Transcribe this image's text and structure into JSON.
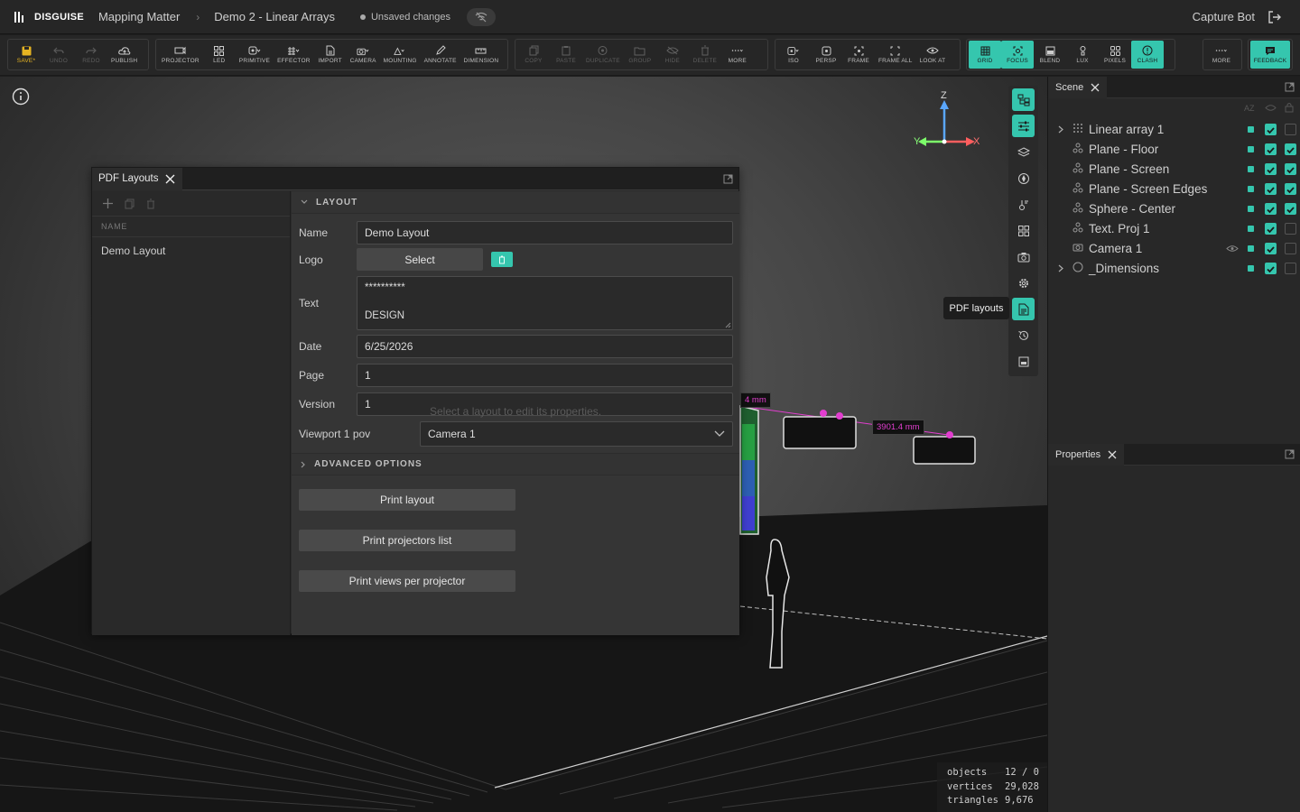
{
  "app": {
    "brand": "DISGUISE",
    "breadcrumb": [
      "Mapping Matter",
      "Demo 2 - Linear Arrays"
    ],
    "status": "Unsaved changes",
    "user": "Capture Bot"
  },
  "toolbar": {
    "file": [
      {
        "label": "SAVE*",
        "icon": "save-icon",
        "state": "accent"
      },
      {
        "label": "UNDO",
        "icon": "undo-icon",
        "state": "disabled"
      },
      {
        "label": "REDO",
        "icon": "redo-icon",
        "state": "disabled"
      },
      {
        "label": "PUBLISH",
        "icon": "cloud-upload-icon"
      }
    ],
    "create": [
      {
        "label": "PROJECTOR",
        "icon": "projector-icon"
      },
      {
        "label": "LED",
        "icon": "led-grid-icon"
      },
      {
        "label": "PRIMITIVE",
        "icon": "primitive-icon"
      },
      {
        "label": "EFFECTOR",
        "icon": "effector-icon"
      },
      {
        "label": "IMPORT",
        "icon": "import-icon"
      },
      {
        "label": "CAMERA",
        "icon": "camera-icon"
      },
      {
        "label": "MOUNTING",
        "icon": "mounting-icon"
      },
      {
        "label": "ANNOTATE",
        "icon": "pencil-icon"
      },
      {
        "label": "DIMENSION",
        "icon": "dimension-icon"
      }
    ],
    "edit": [
      {
        "label": "COPY",
        "icon": "copy-icon",
        "state": "disabled"
      },
      {
        "label": "PASTE",
        "icon": "paste-icon",
        "state": "disabled"
      },
      {
        "label": "DUPLICATE",
        "icon": "duplicate-icon",
        "state": "disabled"
      },
      {
        "label": "GROUP",
        "icon": "group-icon",
        "state": "disabled"
      },
      {
        "label": "HIDE",
        "icon": "hide-icon",
        "state": "disabled"
      },
      {
        "label": "DELETE",
        "icon": "trash-icon",
        "state": "disabled"
      },
      {
        "label": "MORE",
        "icon": "more-icon"
      }
    ],
    "view": [
      {
        "label": "ISO",
        "icon": "iso-icon"
      },
      {
        "label": "PERSP",
        "icon": "persp-icon"
      },
      {
        "label": "FRAME",
        "icon": "frame-icon"
      },
      {
        "label": "FRAME ALL",
        "icon": "frame-all-icon"
      },
      {
        "label": "LOOK AT",
        "icon": "eye-icon"
      }
    ],
    "display": [
      {
        "label": "GRID",
        "icon": "grid-icon",
        "state": "on"
      },
      {
        "label": "FOCUS",
        "icon": "focus-icon",
        "state": "on"
      },
      {
        "label": "BLEND",
        "icon": "blend-icon"
      },
      {
        "label": "LUX",
        "icon": "lux-icon"
      },
      {
        "label": "PIXELS",
        "icon": "pixels-icon"
      },
      {
        "label": "CLASH",
        "icon": "clash-icon",
        "state": "on"
      }
    ],
    "more": {
      "label": "MORE",
      "icon": "more-icon"
    },
    "feedback": {
      "label": "FEEDBACK",
      "icon": "feedback-icon"
    }
  },
  "viewport": {
    "axes": {
      "z": "Z",
      "x": "X",
      "y": "Y"
    },
    "dimension_labels": [
      "4 mm",
      "3901.4 mm"
    ],
    "stats": [
      {
        "key": "objects",
        "value": "12 / 0"
      },
      {
        "key": "vertices",
        "value": "29,028"
      },
      {
        "key": "triangles",
        "value": "9,676"
      }
    ]
  },
  "side_toolbar": {
    "tooltip": "PDF layouts"
  },
  "scene_panel": {
    "title": "Scene",
    "sort_label": "AZ",
    "items": [
      {
        "name": "Linear array 1",
        "icon": "array-icon",
        "expandable": true,
        "visible": true,
        "locked": false
      },
      {
        "name": "Plane - Floor",
        "icon": "mesh-icon",
        "expandable": false,
        "visible": true,
        "locked": true
      },
      {
        "name": "Plane - Screen",
        "icon": "mesh-icon",
        "expandable": false,
        "visible": true,
        "locked": true
      },
      {
        "name": "Plane - Screen Edges",
        "icon": "mesh-icon",
        "expandable": false,
        "visible": true,
        "locked": true
      },
      {
        "name": "Sphere - Center",
        "icon": "mesh-icon",
        "expandable": false,
        "visible": true,
        "locked": true
      },
      {
        "name": "Text. Proj 1",
        "icon": "mesh-icon",
        "expandable": false,
        "visible": true,
        "locked": false
      },
      {
        "name": "Camera 1",
        "icon": "camera-icon",
        "expandable": false,
        "visible": true,
        "locked": false,
        "eye": true
      },
      {
        "name": "_Dimensions",
        "icon": "circle-icon",
        "expandable": true,
        "visible": true,
        "locked": false
      }
    ]
  },
  "properties_panel": {
    "title": "Properties"
  },
  "pdf_dialog": {
    "title": "PDF Layouts",
    "list_header": "NAME",
    "layouts": [
      "Demo Layout"
    ],
    "section_layout": "LAYOUT",
    "section_advanced": "ADVANCED OPTIONS",
    "fields": {
      "name_label": "Name",
      "name_value": "Demo Layout",
      "logo_label": "Logo",
      "logo_button": "Select",
      "text_label": "Text",
      "text_line1": "**********",
      "text_line2": "DESIGN",
      "date_label": "Date",
      "date_value": "6/25/2026",
      "page_label": "Page",
      "page_value": "1",
      "version_label": "Version",
      "version_value": "1",
      "viewport_label": "Viewport 1 pov",
      "viewport_value": "Camera 1"
    },
    "ghost_hint": "Select a layout to edit its properties.",
    "actions": [
      "Print layout",
      "Print projectors list",
      "Print views per projector"
    ]
  },
  "colors": {
    "accent": "#35c6ae",
    "save": "#e6b422",
    "dimension": "#e23ecf"
  }
}
